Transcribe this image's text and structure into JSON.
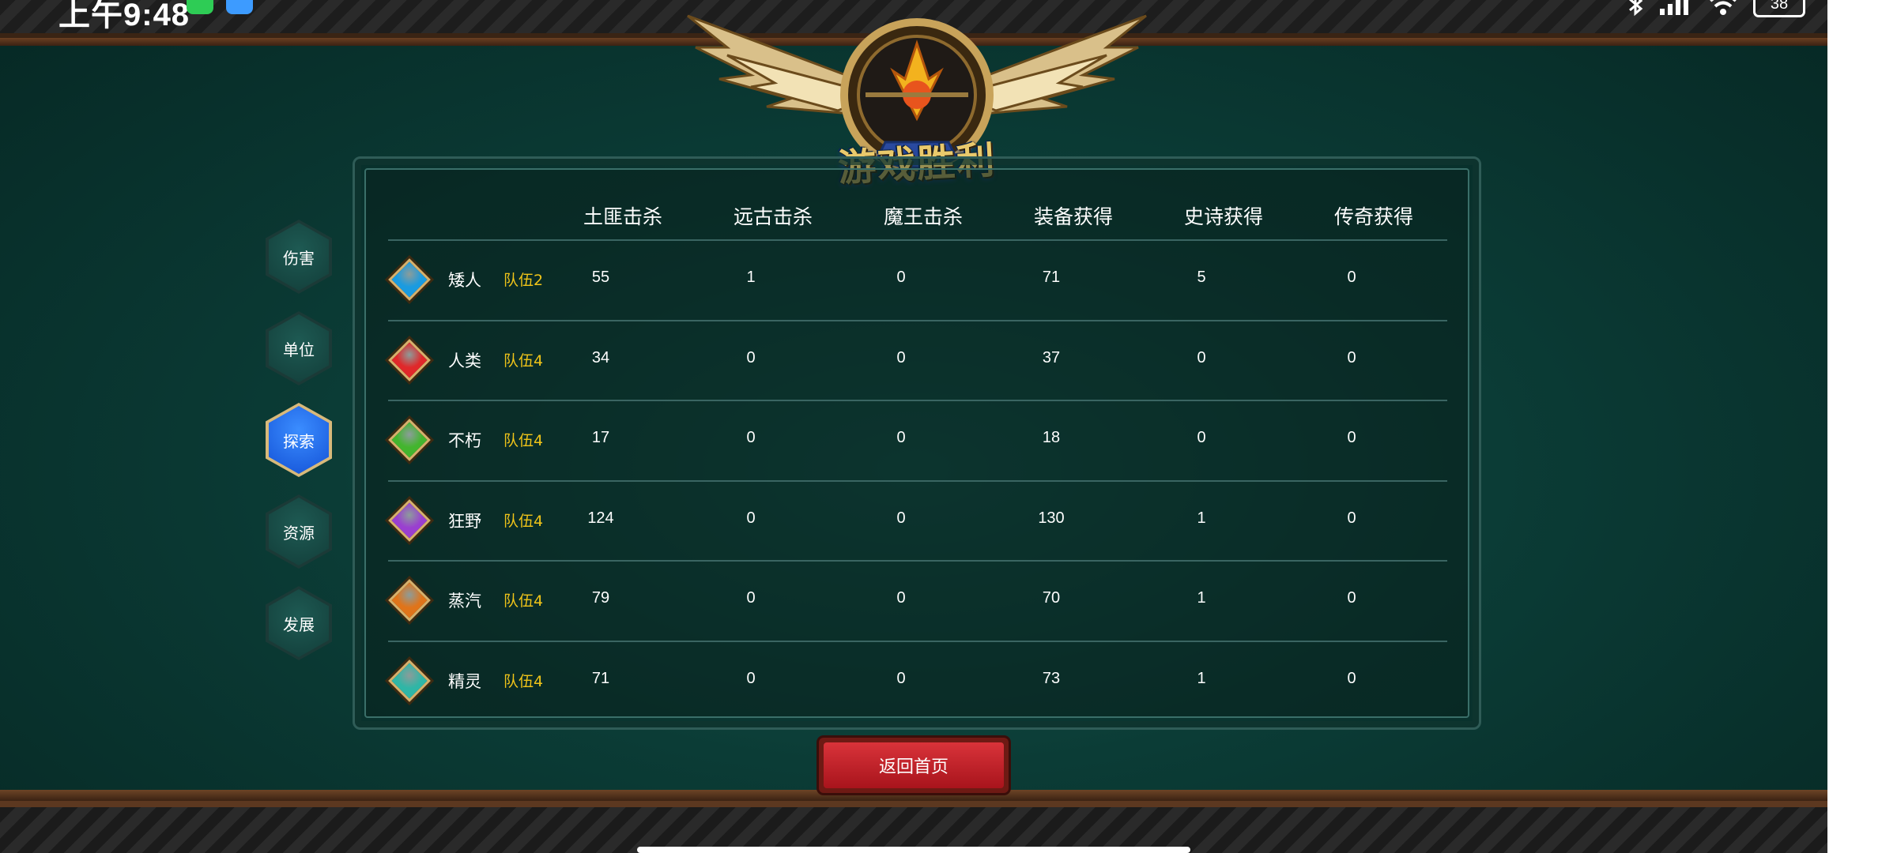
{
  "status_bar": {
    "time": "上午9:48",
    "battery": "38"
  },
  "title": "游戏胜利",
  "side_nav": [
    {
      "label": "伤害",
      "active": false
    },
    {
      "label": "单位",
      "active": false
    },
    {
      "label": "探索",
      "active": true
    },
    {
      "label": "资源",
      "active": false
    },
    {
      "label": "发展",
      "active": false
    }
  ],
  "table": {
    "columns": [
      "土匪击杀",
      "远古击杀",
      "魔王击杀",
      "装备获得",
      "史诗获得",
      "传奇获得"
    ],
    "rows": [
      {
        "race": "矮人",
        "team": "队伍2",
        "gem_color": "#1a9be0",
        "values": [
          "55",
          "1",
          "0",
          "71",
          "5",
          "0"
        ]
      },
      {
        "race": "人类",
        "team": "队伍4",
        "gem_color": "#e0282a",
        "values": [
          "34",
          "0",
          "0",
          "37",
          "0",
          "0"
        ]
      },
      {
        "race": "不朽",
        "team": "队伍4",
        "gem_color": "#43b52e",
        "values": [
          "17",
          "0",
          "0",
          "18",
          "0",
          "0"
        ]
      },
      {
        "race": "狂野",
        "team": "队伍4",
        "gem_color": "#9a3fd0",
        "values": [
          "124",
          "0",
          "0",
          "130",
          "1",
          "0"
        ]
      },
      {
        "race": "蒸汽",
        "team": "队伍4",
        "gem_color": "#e0741a",
        "values": [
          "79",
          "0",
          "0",
          "70",
          "1",
          "0"
        ]
      },
      {
        "race": "精灵",
        "team": "队伍4",
        "gem_color": "#2fb6a6",
        "values": [
          "71",
          "0",
          "0",
          "73",
          "1",
          "0"
        ]
      }
    ]
  },
  "return_button": "返回首页",
  "colors": {
    "background": "#0b3c36",
    "team_tag": "#f0c419",
    "active_tab": "#1351d6",
    "button": "#c41e26"
  }
}
